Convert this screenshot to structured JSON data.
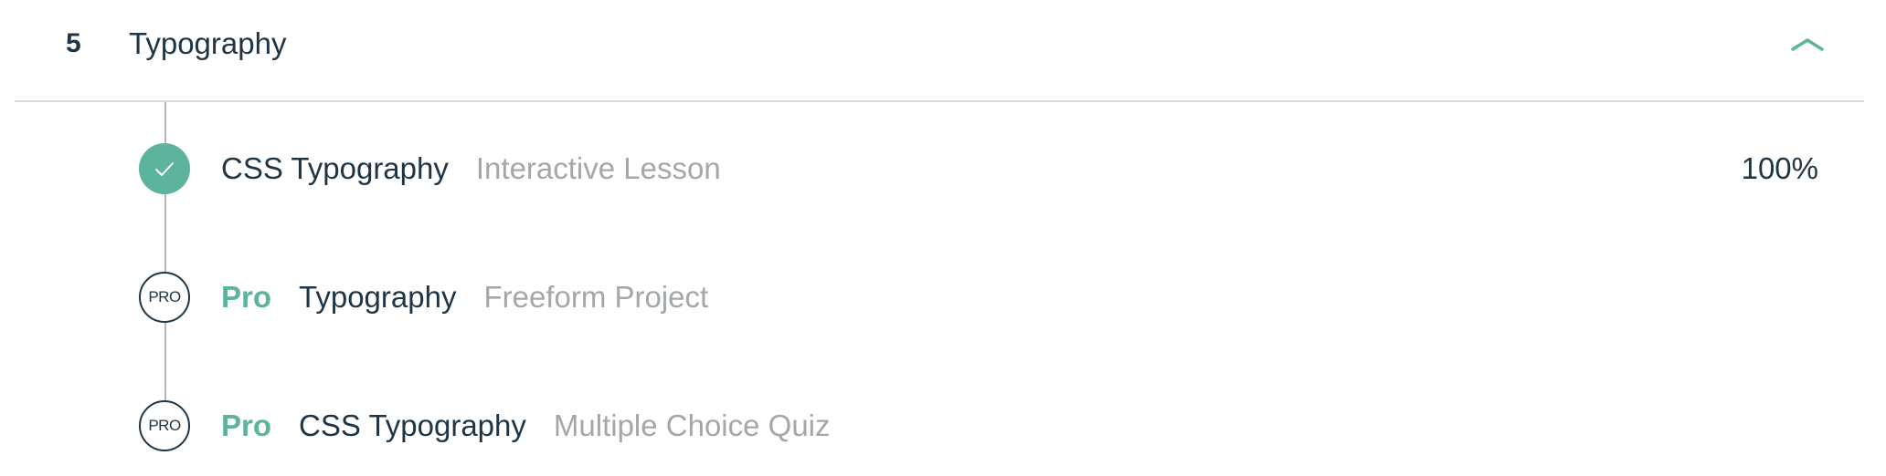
{
  "module": {
    "number": "5",
    "title": "Typography",
    "collapse_icon": "chevron-up-icon"
  },
  "colors": {
    "accent": "#5bb49b",
    "text_dark": "#1f3545",
    "text_muted": "#a4a7aa",
    "divider": "#d7d9db"
  },
  "lessons": [
    {
      "status": "completed",
      "status_icon": "checkmark-icon",
      "pro": "",
      "name": "CSS Typography",
      "type": "Interactive Lesson",
      "progress": "100%"
    },
    {
      "status": "locked-pro",
      "status_icon_label": "PRO",
      "pro": "Pro",
      "name": "Typography",
      "type": "Freeform Project",
      "progress": ""
    },
    {
      "status": "locked-pro",
      "status_icon_label": "PRO",
      "pro": "Pro",
      "name": "CSS Typography",
      "type": "Multiple Choice Quiz",
      "progress": ""
    }
  ]
}
